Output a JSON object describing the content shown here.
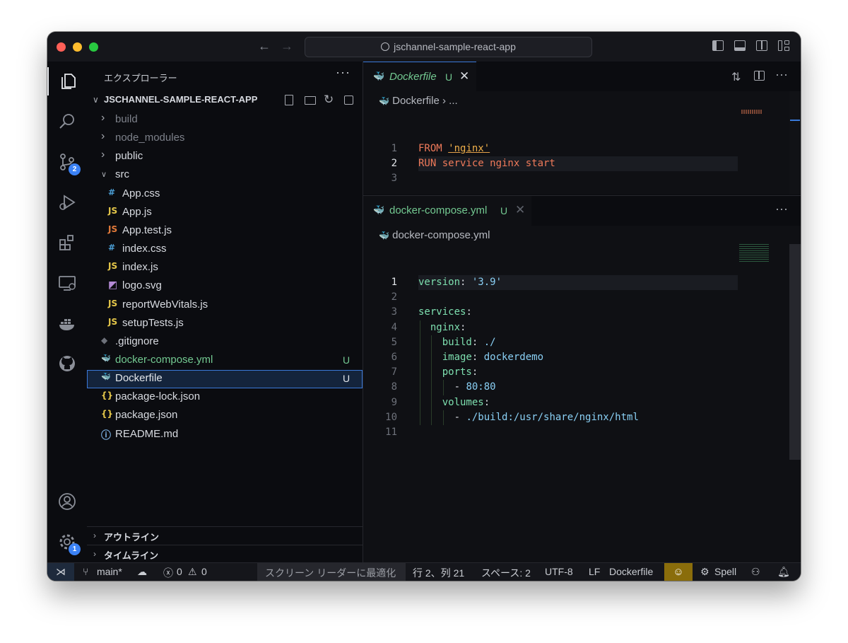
{
  "titlebar": {
    "search_text": "jschannel-sample-react-app"
  },
  "activity": {
    "scm_badge": "2",
    "settings_badge": "1"
  },
  "sidebar": {
    "title": "エクスプローラー",
    "more": "···",
    "project": "JSCHANNEL-SAMPLE-REACT-APP",
    "tree": [
      {
        "label": "build",
        "kind": "folder",
        "open": false,
        "muted": true,
        "status": ""
      },
      {
        "label": "node_modules",
        "kind": "folder",
        "open": false,
        "muted": true,
        "status": ""
      },
      {
        "label": "public",
        "kind": "folder",
        "open": false,
        "muted": false,
        "status": ""
      },
      {
        "label": "src",
        "kind": "folder",
        "open": true,
        "muted": false,
        "status": ""
      },
      {
        "label": "App.css",
        "kind": "css",
        "icon": "#",
        "status": ""
      },
      {
        "label": "App.js",
        "kind": "js",
        "icon": "JS",
        "status": ""
      },
      {
        "label": "App.test.js",
        "kind": "test",
        "icon": "JS",
        "status": ""
      },
      {
        "label": "index.css",
        "kind": "css",
        "icon": "#",
        "status": ""
      },
      {
        "label": "index.js",
        "kind": "js",
        "icon": "JS",
        "status": ""
      },
      {
        "label": "logo.svg",
        "kind": "svg",
        "icon": "◩",
        "status": ""
      },
      {
        "label": "reportWebVitals.js",
        "kind": "js",
        "icon": "JS",
        "status": ""
      },
      {
        "label": "setupTests.js",
        "kind": "js",
        "icon": "JS",
        "status": ""
      },
      {
        "label": ".gitignore",
        "kind": "git",
        "icon": "◆",
        "status": ""
      },
      {
        "label": "docker-compose.yml",
        "kind": "compose",
        "icon": "🐳",
        "status": "U"
      },
      {
        "label": "Dockerfile",
        "kind": "docker",
        "icon": "🐳",
        "status": "U"
      },
      {
        "label": "package-lock.json",
        "kind": "json",
        "icon": "{}",
        "status": ""
      },
      {
        "label": "package.json",
        "kind": "json",
        "icon": "{}",
        "status": ""
      },
      {
        "label": "README.md",
        "kind": "info",
        "icon": "ⓘ",
        "status": ""
      }
    ],
    "outline": "アウトライン",
    "timeline": "タイムライン"
  },
  "editor1": {
    "tab_name": "Dockerfile",
    "tab_status": "U",
    "breadcrumb": "Dockerfile",
    "breadcrumb_more": "...",
    "lines": [
      {
        "n": "1",
        "parts": [
          {
            "t": "FROM ",
            "c": "kw"
          },
          {
            "t": "'nginx'",
            "c": "str"
          }
        ]
      },
      {
        "n": "2",
        "parts": [
          {
            "t": "RUN service nginx start",
            "c": "kw2"
          }
        ]
      },
      {
        "n": "3",
        "parts": []
      }
    ]
  },
  "editor2": {
    "tab_name": "docker-compose.yml",
    "tab_status": "U",
    "breadcrumb": "docker-compose.yml",
    "lines": [
      {
        "n": "1",
        "parts": [
          {
            "t": "version",
            "c": "key"
          },
          {
            "t": ": ",
            "c": "plain"
          },
          {
            "t": "'3.9'",
            "c": "val"
          }
        ]
      },
      {
        "n": "2",
        "parts": []
      },
      {
        "n": "3",
        "parts": [
          {
            "t": "services",
            "c": "key"
          },
          {
            "t": ":",
            "c": "plain"
          }
        ]
      },
      {
        "n": "4",
        "parts": [
          {
            "t": "  nginx",
            "c": "key"
          },
          {
            "t": ":",
            "c": "plain"
          }
        ]
      },
      {
        "n": "5",
        "parts": [
          {
            "t": "    build",
            "c": "key"
          },
          {
            "t": ": ",
            "c": "plain"
          },
          {
            "t": "./",
            "c": "val"
          }
        ]
      },
      {
        "n": "6",
        "parts": [
          {
            "t": "    image",
            "c": "key"
          },
          {
            "t": ": ",
            "c": "plain"
          },
          {
            "t": "dockerdemo",
            "c": "val"
          }
        ]
      },
      {
        "n": "7",
        "parts": [
          {
            "t": "    ports",
            "c": "key"
          },
          {
            "t": ":",
            "c": "plain"
          }
        ]
      },
      {
        "n": "8",
        "parts": [
          {
            "t": "      - ",
            "c": "plain"
          },
          {
            "t": "80:80",
            "c": "val"
          }
        ]
      },
      {
        "n": "9",
        "parts": [
          {
            "t": "    volumes",
            "c": "key"
          },
          {
            "t": ":",
            "c": "plain"
          }
        ]
      },
      {
        "n": "10",
        "parts": [
          {
            "t": "      - ",
            "c": "plain"
          },
          {
            "t": "./build:/usr/share/nginx/html",
            "c": "val"
          }
        ]
      },
      {
        "n": "11",
        "parts": []
      }
    ]
  },
  "statusbar": {
    "branch": "main*",
    "errors": "0",
    "warnings": "0",
    "screen_reader": "スクリーン リーダーに最適化",
    "position": "行 2、列 21",
    "spaces": "スペース: 2",
    "encoding": "UTF-8",
    "eol": "LF",
    "language": "Dockerfile",
    "spell": "Spell"
  },
  "colors": {
    "accent": "#3a79d9",
    "untracked": "#73c991",
    "copilot_bg": "#8a6d0b"
  }
}
